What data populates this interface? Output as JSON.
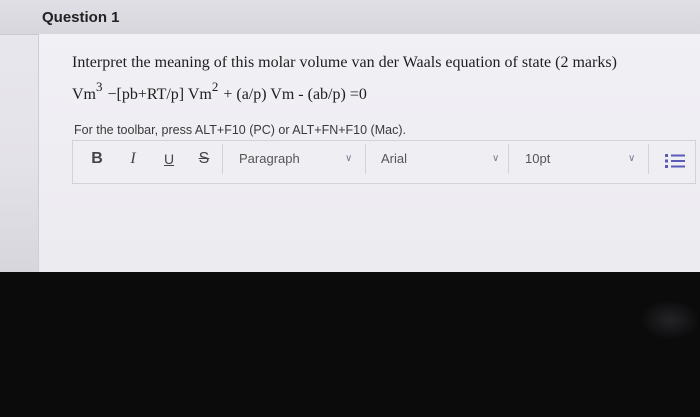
{
  "question": {
    "title": "Question 1",
    "prompt": "Interpret the meaning of this molar volume van der Waals equation of state (2 marks)",
    "equation": {
      "term1": "Vm",
      "exp1": "3",
      "term2": " −[pb+RT/p] Vm",
      "exp2": "2",
      "term3": " + (a/p) Vm - (ab/p) =0"
    }
  },
  "editor": {
    "hint": "For the toolbar, press ALT+F10 (PC) or ALT+FN+F10 (Mac).",
    "toolbar": {
      "bold": "B",
      "italic": "I",
      "underline": "U",
      "strike": "S",
      "paragraph_select": "Paragraph",
      "font_select": "Arial",
      "size_select": "10pt"
    }
  }
}
